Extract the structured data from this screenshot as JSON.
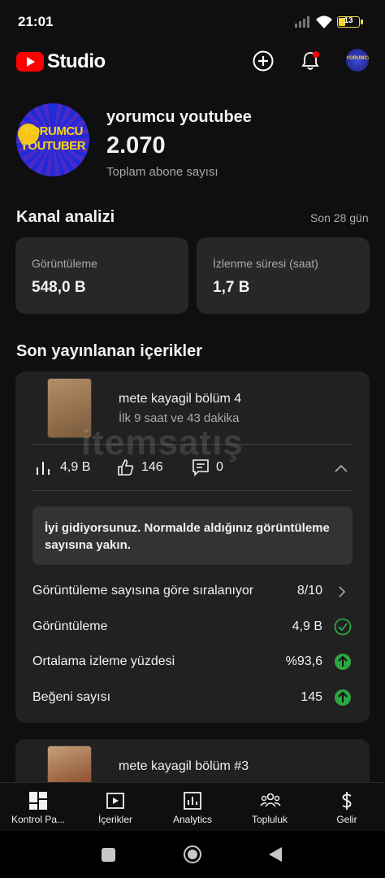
{
  "status_bar": {
    "time": "21:01",
    "battery": "13"
  },
  "header": {
    "logo_text": "Studio",
    "icons": [
      "create-icon",
      "bell-icon",
      "account-avatar"
    ]
  },
  "channel": {
    "name": "yorumcu youtubee",
    "subscribers": "2.070",
    "subscribers_label": "Toplam abone sayısı",
    "avatar_text_1": "YORUMCU",
    "avatar_text_2": "YOUTUBER"
  },
  "analytics": {
    "title": "Kanal analizi",
    "period": "Son 28 gün",
    "cards": [
      {
        "label": "Görüntüleme",
        "value": "548,0 B"
      },
      {
        "label": "İzlenme süresi (saat)",
        "value": "1,7 B"
      }
    ]
  },
  "recent": {
    "title": "Son yayınlanan içerikler",
    "items": [
      {
        "title": "mete kayagil bölüm 4",
        "subtitle": "İlk 9 saat ve 43 dakika",
        "views": "4,9 B",
        "likes": "146",
        "comments": "0",
        "message": "İyi gidiyorsunuz. Normalde aldığınız görüntüleme sayısına yakın.",
        "metrics": [
          {
            "label": "Görüntüleme sayısına göre sıralanıyor",
            "value": "8/10",
            "indicator": "chevron-right"
          },
          {
            "label": "Görüntüleme",
            "value": "4,9 B",
            "indicator": "check-circle"
          },
          {
            "label": "Ortalama izleme yüzdesi",
            "value": "%93,6",
            "indicator": "up-arrow-circle"
          },
          {
            "label": "Beğeni sayısı",
            "value": "145",
            "indicator": "up-arrow-circle"
          }
        ]
      },
      {
        "title": "mete kayagil bölüm #3"
      }
    ]
  },
  "watermark": "itemsatış",
  "bottom_nav": [
    {
      "label": "Kontrol Pa..."
    },
    {
      "label": "İçerikler"
    },
    {
      "label": "Analytics"
    },
    {
      "label": "Topluluk"
    },
    {
      "label": "Gelir"
    }
  ],
  "colors": {
    "background": "#0f0f0f",
    "card": "#272727",
    "accent_red": "#ff0000",
    "success_green": "#2ba640"
  }
}
